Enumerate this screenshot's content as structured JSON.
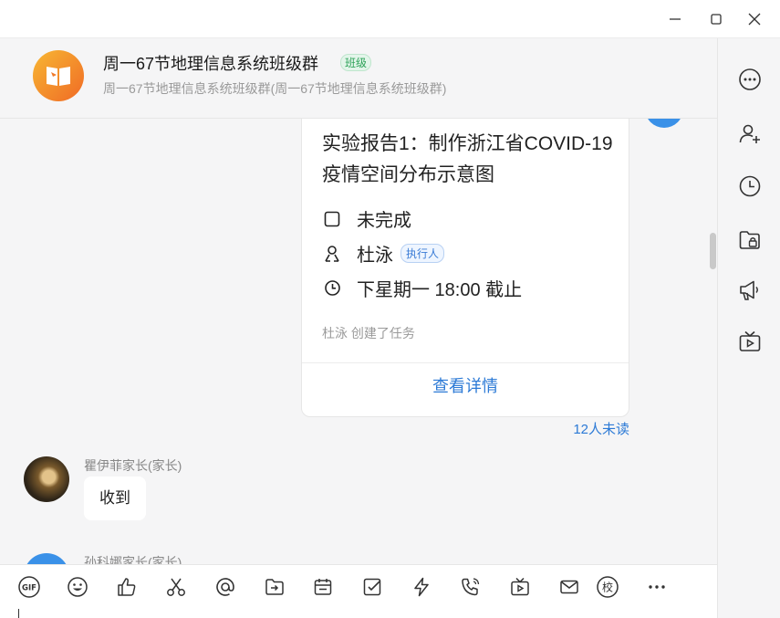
{
  "header": {
    "title": "周一67节地理信息系统班级群",
    "badge": "班级",
    "subtitle": "周一67节地理信息系统班级群(周一67节地理信息系统班级群)"
  },
  "task_card": {
    "title": "实验报告1：制作浙江省COVID-19疫情空间分布示意图",
    "status": "未完成",
    "assignee": "杜泳",
    "assignee_tag": "执行人",
    "deadline": "下星期一 18:00 截止",
    "created_by": "杜泳 创建了任务",
    "detail_link": "查看详情"
  },
  "unread_count": "12人未读",
  "messages": [
    {
      "sender": "瞿伊菲家长(家长)",
      "text": "收到"
    },
    {
      "sender": "孙科娜家长(家长)"
    }
  ],
  "toolbar": {
    "items": [
      "gif-icon",
      "emoji-icon",
      "thumbs-up-icon",
      "scissors-icon",
      "at-icon",
      "file-transfer-icon",
      "calendar-icon",
      "task-check-icon",
      "lightning-icon",
      "phone-icon",
      "live-tv-icon",
      "mail-icon",
      "school-icon",
      "more-icon"
    ]
  },
  "sidebar": {
    "items": [
      "more-options-icon",
      "add-member-icon",
      "history-icon",
      "group-files-icon",
      "announcement-icon",
      "live-icon"
    ]
  },
  "colors": {
    "accent": "#2c7ad6",
    "badge_green": "#2fa35a",
    "avatar_orange": "#f06a25"
  }
}
